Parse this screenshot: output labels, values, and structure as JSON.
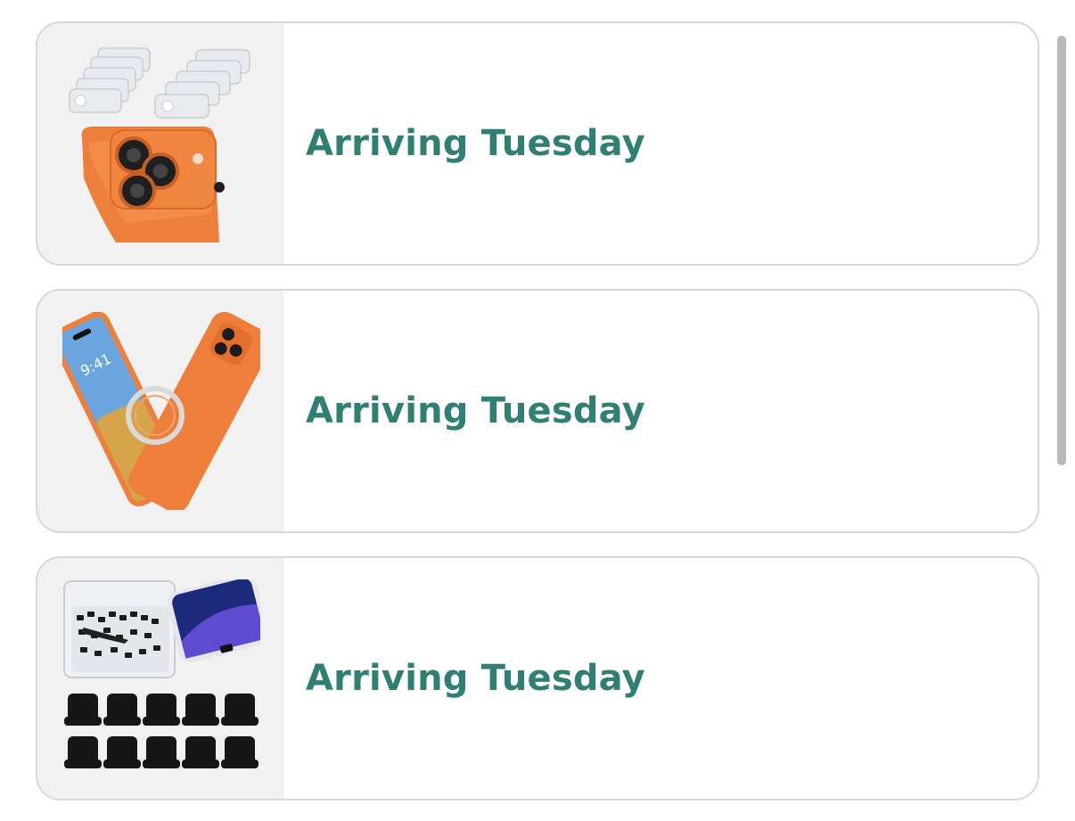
{
  "orders": [
    {
      "status": "Arriving Tuesday",
      "image_icon": "camera-lens-protector-icon"
    },
    {
      "status": "Arriving Tuesday",
      "image_icon": "phone-case-icon"
    },
    {
      "status": "Arriving Tuesday",
      "image_icon": "dust-plug-icon"
    }
  ],
  "colors": {
    "status_text": "#2f7f73",
    "card_border": "#d8d8d8",
    "thumb_background": "#f1f1f2",
    "accent_orange": "#ee7f3b"
  }
}
